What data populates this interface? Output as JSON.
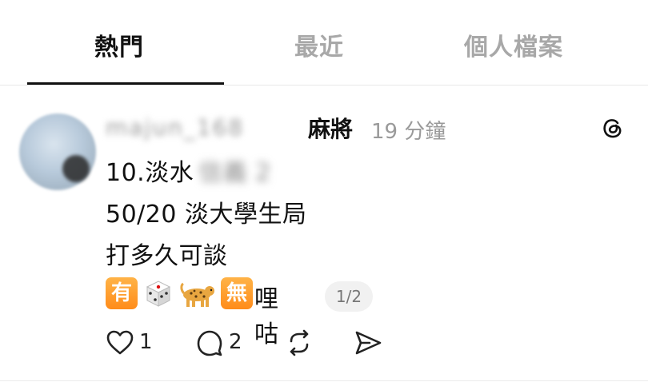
{
  "tabs": [
    {
      "label": "熱門",
      "active": true
    },
    {
      "label": "最近",
      "active": false
    },
    {
      "label": "個人檔案",
      "active": false
    }
  ],
  "post": {
    "username": "majun_168",
    "topic": "麻將",
    "time": "19 分鐘",
    "lines": [
      "10.淡水",
      "50/20 淡大學生局",
      "打多久可談"
    ],
    "line1_hidden": "信義 2",
    "emoji_badges": [
      "有",
      "無"
    ],
    "emoji_icons": [
      "dice-icon",
      "leopard-icon"
    ],
    "emoji_tail_text": "哩咕",
    "page_indicator": "1/2",
    "likes": "1",
    "replies": "2",
    "accent_orange": "#ff8c1a"
  }
}
